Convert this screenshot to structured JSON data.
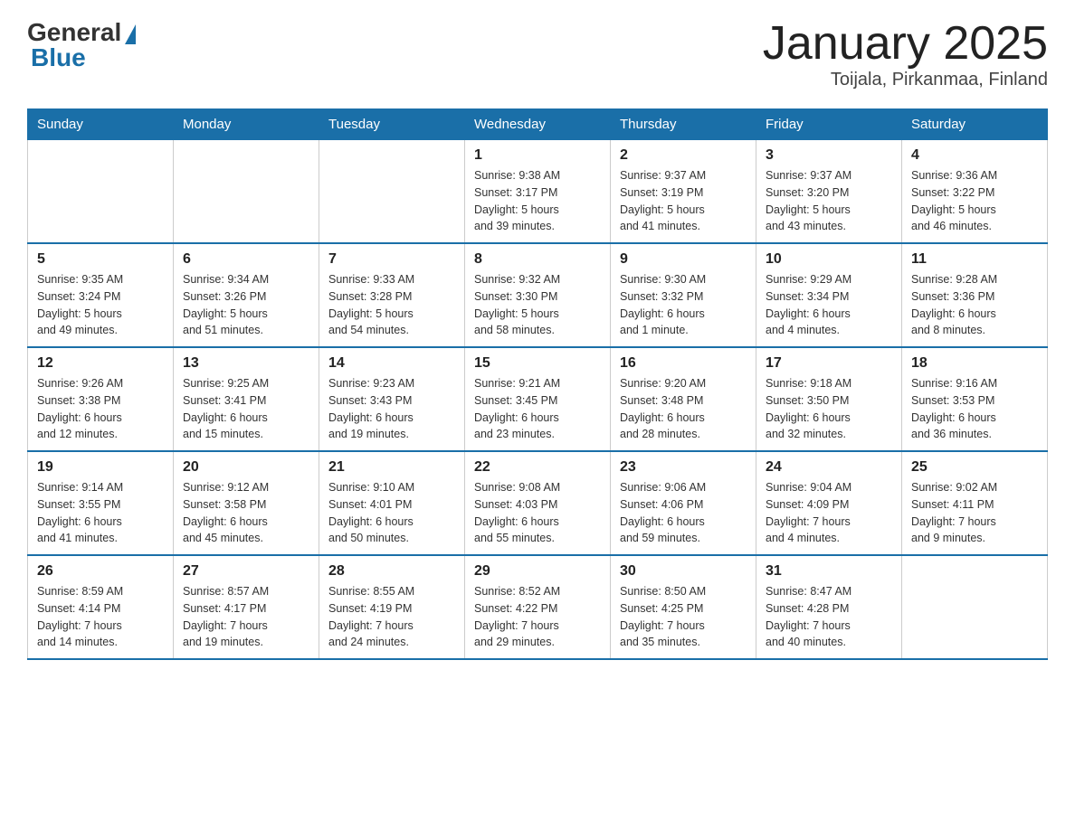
{
  "header": {
    "logo": {
      "text_general": "General",
      "text_blue": "Blue",
      "tagline": ""
    },
    "title": "January 2025",
    "subtitle": "Toijala, Pirkanmaa, Finland"
  },
  "weekdays": [
    "Sunday",
    "Monday",
    "Tuesday",
    "Wednesday",
    "Thursday",
    "Friday",
    "Saturday"
  ],
  "weeks": [
    [
      {
        "day": "",
        "info": ""
      },
      {
        "day": "",
        "info": ""
      },
      {
        "day": "",
        "info": ""
      },
      {
        "day": "1",
        "info": "Sunrise: 9:38 AM\nSunset: 3:17 PM\nDaylight: 5 hours\nand 39 minutes."
      },
      {
        "day": "2",
        "info": "Sunrise: 9:37 AM\nSunset: 3:19 PM\nDaylight: 5 hours\nand 41 minutes."
      },
      {
        "day": "3",
        "info": "Sunrise: 9:37 AM\nSunset: 3:20 PM\nDaylight: 5 hours\nand 43 minutes."
      },
      {
        "day": "4",
        "info": "Sunrise: 9:36 AM\nSunset: 3:22 PM\nDaylight: 5 hours\nand 46 minutes."
      }
    ],
    [
      {
        "day": "5",
        "info": "Sunrise: 9:35 AM\nSunset: 3:24 PM\nDaylight: 5 hours\nand 49 minutes."
      },
      {
        "day": "6",
        "info": "Sunrise: 9:34 AM\nSunset: 3:26 PM\nDaylight: 5 hours\nand 51 minutes."
      },
      {
        "day": "7",
        "info": "Sunrise: 9:33 AM\nSunset: 3:28 PM\nDaylight: 5 hours\nand 54 minutes."
      },
      {
        "day": "8",
        "info": "Sunrise: 9:32 AM\nSunset: 3:30 PM\nDaylight: 5 hours\nand 58 minutes."
      },
      {
        "day": "9",
        "info": "Sunrise: 9:30 AM\nSunset: 3:32 PM\nDaylight: 6 hours\nand 1 minute."
      },
      {
        "day": "10",
        "info": "Sunrise: 9:29 AM\nSunset: 3:34 PM\nDaylight: 6 hours\nand 4 minutes."
      },
      {
        "day": "11",
        "info": "Sunrise: 9:28 AM\nSunset: 3:36 PM\nDaylight: 6 hours\nand 8 minutes."
      }
    ],
    [
      {
        "day": "12",
        "info": "Sunrise: 9:26 AM\nSunset: 3:38 PM\nDaylight: 6 hours\nand 12 minutes."
      },
      {
        "day": "13",
        "info": "Sunrise: 9:25 AM\nSunset: 3:41 PM\nDaylight: 6 hours\nand 15 minutes."
      },
      {
        "day": "14",
        "info": "Sunrise: 9:23 AM\nSunset: 3:43 PM\nDaylight: 6 hours\nand 19 minutes."
      },
      {
        "day": "15",
        "info": "Sunrise: 9:21 AM\nSunset: 3:45 PM\nDaylight: 6 hours\nand 23 minutes."
      },
      {
        "day": "16",
        "info": "Sunrise: 9:20 AM\nSunset: 3:48 PM\nDaylight: 6 hours\nand 28 minutes."
      },
      {
        "day": "17",
        "info": "Sunrise: 9:18 AM\nSunset: 3:50 PM\nDaylight: 6 hours\nand 32 minutes."
      },
      {
        "day": "18",
        "info": "Sunrise: 9:16 AM\nSunset: 3:53 PM\nDaylight: 6 hours\nand 36 minutes."
      }
    ],
    [
      {
        "day": "19",
        "info": "Sunrise: 9:14 AM\nSunset: 3:55 PM\nDaylight: 6 hours\nand 41 minutes."
      },
      {
        "day": "20",
        "info": "Sunrise: 9:12 AM\nSunset: 3:58 PM\nDaylight: 6 hours\nand 45 minutes."
      },
      {
        "day": "21",
        "info": "Sunrise: 9:10 AM\nSunset: 4:01 PM\nDaylight: 6 hours\nand 50 minutes."
      },
      {
        "day": "22",
        "info": "Sunrise: 9:08 AM\nSunset: 4:03 PM\nDaylight: 6 hours\nand 55 minutes."
      },
      {
        "day": "23",
        "info": "Sunrise: 9:06 AM\nSunset: 4:06 PM\nDaylight: 6 hours\nand 59 minutes."
      },
      {
        "day": "24",
        "info": "Sunrise: 9:04 AM\nSunset: 4:09 PM\nDaylight: 7 hours\nand 4 minutes."
      },
      {
        "day": "25",
        "info": "Sunrise: 9:02 AM\nSunset: 4:11 PM\nDaylight: 7 hours\nand 9 minutes."
      }
    ],
    [
      {
        "day": "26",
        "info": "Sunrise: 8:59 AM\nSunset: 4:14 PM\nDaylight: 7 hours\nand 14 minutes."
      },
      {
        "day": "27",
        "info": "Sunrise: 8:57 AM\nSunset: 4:17 PM\nDaylight: 7 hours\nand 19 minutes."
      },
      {
        "day": "28",
        "info": "Sunrise: 8:55 AM\nSunset: 4:19 PM\nDaylight: 7 hours\nand 24 minutes."
      },
      {
        "day": "29",
        "info": "Sunrise: 8:52 AM\nSunset: 4:22 PM\nDaylight: 7 hours\nand 29 minutes."
      },
      {
        "day": "30",
        "info": "Sunrise: 8:50 AM\nSunset: 4:25 PM\nDaylight: 7 hours\nand 35 minutes."
      },
      {
        "day": "31",
        "info": "Sunrise: 8:47 AM\nSunset: 4:28 PM\nDaylight: 7 hours\nand 40 minutes."
      },
      {
        "day": "",
        "info": ""
      }
    ]
  ]
}
